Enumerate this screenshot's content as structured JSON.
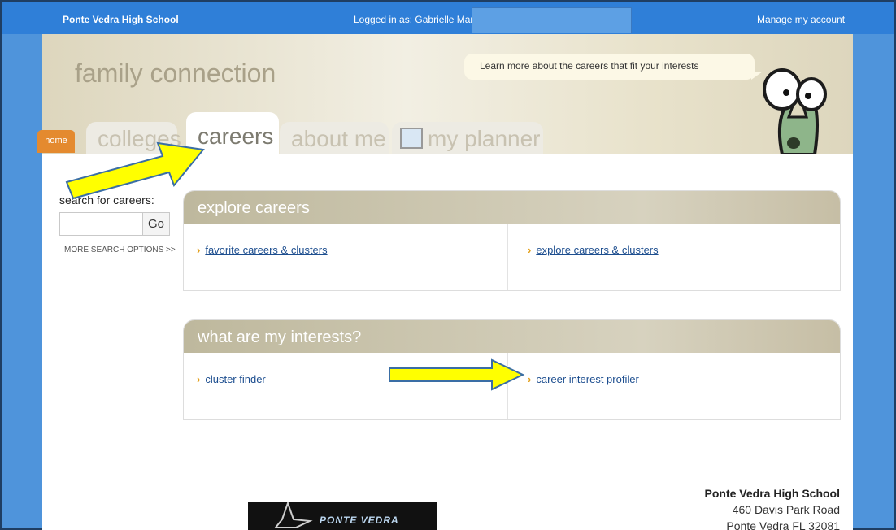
{
  "topbar": {
    "school": "Ponte Vedra High School",
    "logged_in": "Logged in as: Gabrielle Mar",
    "manage": "Manage my account"
  },
  "header": {
    "brand": "family connection",
    "bubble": "Learn more about the careers that fit your interests"
  },
  "tabs": [
    {
      "label": "home"
    },
    {
      "label": "colleges"
    },
    {
      "label": "careers"
    },
    {
      "label": "about me"
    },
    {
      "label": "my planner"
    }
  ],
  "search": {
    "label": "search for careers:",
    "go": "Go",
    "more": "MORE SEARCH OPTIONS >>"
  },
  "panels": [
    {
      "title": "explore careers",
      "left_link": "favorite careers & clusters",
      "right_link": "explore careers & clusters"
    },
    {
      "title": "what are my interests?",
      "left_link": "cluster finder",
      "right_link": "career interest profiler"
    }
  ],
  "footer": {
    "school": "Ponte Vedra High School",
    "address1": "460 Davis Park Road",
    "address2": "Ponte Vedra FL 32081",
    "logo_text": "PONTE VEDRA"
  },
  "colors": {
    "topbar": "#2f7fd8",
    "accent_orange": "#e48a2f",
    "link": "#1d4e8f",
    "annotation_arrow": "#ffff00"
  }
}
